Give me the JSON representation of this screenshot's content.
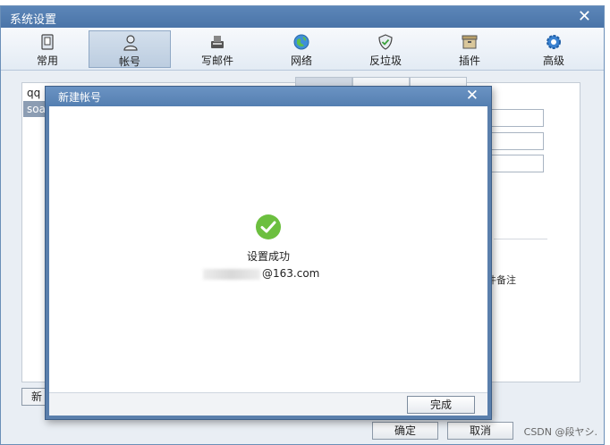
{
  "window": {
    "title": "系统设置"
  },
  "toolbar": {
    "items": [
      {
        "label": "常用",
        "icon": "common-icon",
        "active": false
      },
      {
        "label": "帐号",
        "icon": "account-icon",
        "active": true
      },
      {
        "label": "写邮件",
        "icon": "compose-icon",
        "active": false
      },
      {
        "label": "网络",
        "icon": "network-icon",
        "active": false
      },
      {
        "label": "反垃圾",
        "icon": "shield-icon",
        "active": false
      },
      {
        "label": "插件",
        "icon": "plugin-icon",
        "active": false
      },
      {
        "label": "高级",
        "icon": "gear-icon",
        "active": false
      }
    ]
  },
  "background": {
    "accounts": [
      "qq",
      "soa"
    ],
    "note": "件备注",
    "new_button": "新",
    "ok_button": "确定",
    "cancel_button": "取消",
    "watermark": "CSDN @段ヤシ."
  },
  "dialog": {
    "title": "新建帐号",
    "success_text": "设置成功",
    "email_suffix": "@163.com",
    "finish_button": "完成"
  },
  "colors": {
    "titlebar": "#4a74a8",
    "success_green": "#6cbf3f"
  }
}
